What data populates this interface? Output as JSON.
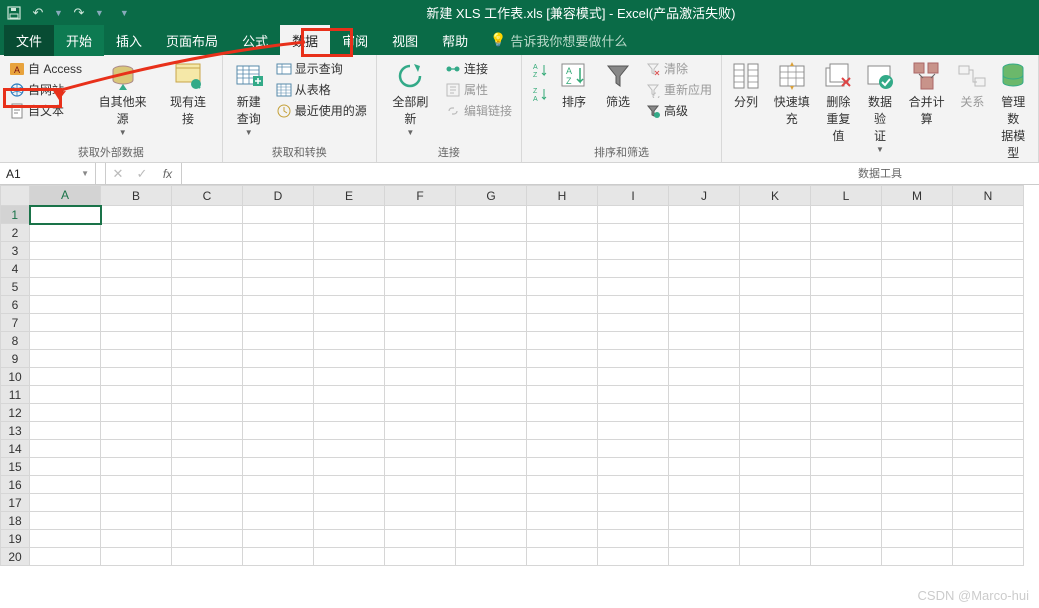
{
  "titlebar": {
    "title": "新建 XLS 工作表.xls  [兼容模式]  -  Excel(产品激活失败)"
  },
  "qat": {
    "save": "💾",
    "undo": "↶",
    "redo": "↷"
  },
  "menu": {
    "file": "文件",
    "home": "开始",
    "insert": "插入",
    "layout": "页面布局",
    "formula": "公式",
    "data": "数据",
    "review": "审阅",
    "view": "视图",
    "help": "帮助",
    "tellme": "告诉我你想要做什么"
  },
  "ribbon": {
    "g1": {
      "access": "自 Access",
      "web": "自网站",
      "text": "自文本",
      "other": "自其他来源",
      "existing": "现有连接",
      "label": "获取外部数据"
    },
    "g2": {
      "newquery": "新建\n查询",
      "showquery": "显示查询",
      "fromtable": "从表格",
      "recent": "最近使用的源",
      "label": "获取和转换"
    },
    "g3": {
      "refreshall": "全部刷新",
      "connections": "连接",
      "properties": "属性",
      "editlinks": "编辑链接",
      "label": "连接"
    },
    "g4": {
      "az": "A→Z",
      "za": "Z→A",
      "sort": "排序",
      "filter": "筛选",
      "clear": "清除",
      "reapply": "重新应用",
      "advanced": "高级",
      "label": "排序和筛选"
    },
    "g5": {
      "texttocol": "分列",
      "flashfill": "快速填充",
      "removedup": "删除\n重复值",
      "datavalid": "数据验\n证",
      "consolidate": "合并计算",
      "relations": "关系",
      "datamodel": "管理数\n据模型",
      "label": "数据工具"
    }
  },
  "formula": {
    "namebox": "A1",
    "fx": "fx"
  },
  "grid": {
    "columns": [
      "A",
      "B",
      "C",
      "D",
      "E",
      "F",
      "G",
      "H",
      "I",
      "J",
      "K",
      "L",
      "M",
      "N"
    ],
    "rows": [
      "1",
      "2",
      "3",
      "4",
      "5",
      "6",
      "7",
      "8",
      "9",
      "10",
      "11",
      "12",
      "13",
      "14",
      "15",
      "16",
      "17",
      "18",
      "19",
      "20"
    ],
    "selected": "A1"
  },
  "watermark": "CSDN @Marco-hui"
}
